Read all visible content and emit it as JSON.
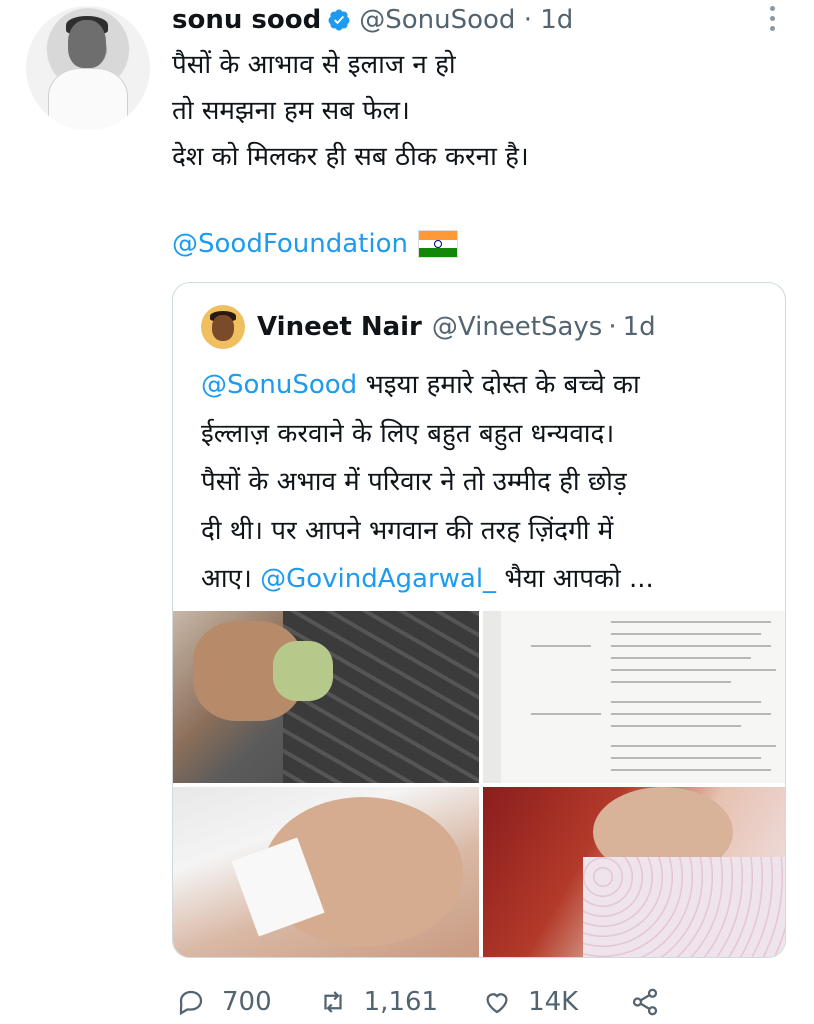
{
  "author": {
    "name": "sonu sood",
    "handle": "@SonuSood",
    "time": "1d"
  },
  "tweet": {
    "lines": [
      "पैसों के आभाव से इलाज न हो",
      "तो समझना हम सब फेल।",
      "देश को मिलकर ही सब ठीक करना है।"
    ],
    "mention": "@SoodFoundation"
  },
  "quoted": {
    "name": "Vineet Nair",
    "handle": "@VineetSays",
    "time": "1d",
    "line1_mention": "@SonuSood",
    "line1_rest": " भइया हमारे दोस्त के बच्चे का",
    "line2": "ईल्लाज़ करवाने के लिए बहुत बहुत धन्यवाद।",
    "line3": "पैसों के अभाव में परिवार ने तो उम्मीद ही छोड़",
    "line4": "दी थी। पर आपने भगवान की तरह ज़िंदगी में",
    "line5_pre": "आए। ",
    "line5_mention": "@GovindAgarwal_",
    "line5_rest": " भैया आपको ..."
  },
  "actions": {
    "replies": "700",
    "retweets": "1,161",
    "likes": "14K"
  },
  "colors": {
    "link": "#1d9bf0",
    "secondary": "#536471",
    "border": "#cfd9de"
  }
}
